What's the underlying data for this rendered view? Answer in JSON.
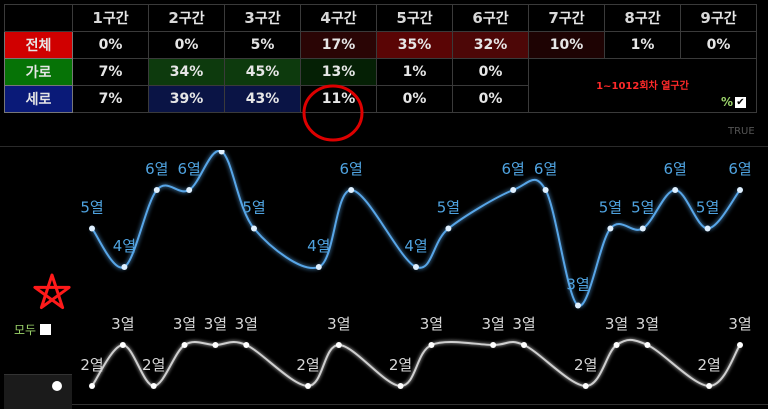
{
  "table": {
    "headers": [
      {
        "num": "1",
        "unit": "구간"
      },
      {
        "num": "2",
        "unit": "구간"
      },
      {
        "num": "3",
        "unit": "구간"
      },
      {
        "num": "4",
        "unit": "구간"
      },
      {
        "num": "5",
        "unit": "구간"
      },
      {
        "num": "6",
        "unit": "구간"
      },
      {
        "num": "7",
        "unit": "구간"
      },
      {
        "num": "8",
        "unit": "구간"
      },
      {
        "num": "9",
        "unit": "구간"
      }
    ],
    "rows": [
      {
        "label": "전체",
        "cls": "total",
        "vcls": "v-total",
        "values": [
          "0%",
          "0%",
          "5%",
          "17%",
          "35%",
          "32%",
          "10%",
          "1%",
          "0%"
        ],
        "bgs": [
          "#000000",
          "#000000",
          "#000000",
          "#2a0505",
          "#5a0505",
          "#4d0707",
          "#1e0303",
          "#000000",
          "#000000"
        ]
      },
      {
        "label": "가로",
        "cls": "garo",
        "vcls": "v-garo",
        "values": [
          "7%",
          "34%",
          "45%",
          "13%",
          "1%",
          "0%"
        ],
        "bgs": [
          "#000000",
          "#0d3a0d",
          "#0d3a0d",
          "#052005",
          "#000000",
          "#000000"
        ]
      },
      {
        "label": "세로",
        "cls": "sero",
        "vcls": "v-sero",
        "values": [
          "7%",
          "39%",
          "43%",
          "11%",
          "0%",
          "0%"
        ],
        "bgs": [
          "#000000",
          "#0a1445",
          "#0a1445",
          "#000000",
          "#000000",
          "#000000"
        ]
      }
    ],
    "range_note": "1~1012회차 열구간",
    "percent_label": "%",
    "percent_checked": "✔",
    "true_label": "TRUE",
    "annotation_circle_color": "#dd0000"
  },
  "all_label": "모두",
  "chart_data": {
    "type": "line",
    "x": [
      1,
      2,
      3,
      4,
      5,
      6,
      7,
      8,
      9,
      10,
      11,
      12,
      13,
      14,
      15,
      16,
      17,
      18,
      19,
      20,
      21,
      22,
      23,
      24,
      25,
      26,
      27,
      28,
      29
    ],
    "series": [
      {
        "color": "#58a6e8",
        "labels": [
          "5열",
          "4열",
          "6열",
          "6열",
          "7열",
          "5열",
          "4열",
          "6열",
          "4열",
          "5열",
          "6열",
          "6열",
          "3열",
          "5열",
          "5열",
          "6열",
          "5열",
          "6열"
        ],
        "values": [
          5,
          4,
          6,
          6,
          7,
          5,
          4,
          6,
          4,
          5,
          6,
          6,
          3,
          5,
          5,
          6,
          5,
          6
        ]
      },
      {
        "color": "#cfcfcf",
        "labels": [
          "2열",
          "3열",
          "2열",
          "3열",
          "3열",
          "3열",
          "2열",
          "3열",
          "2열",
          "3열",
          "3열",
          "3열",
          "2열",
          "3열",
          "3열",
          "2열",
          "3열"
        ],
        "values": [
          2,
          3,
          2,
          3,
          3,
          3,
          2,
          3,
          2,
          3,
          3,
          3,
          2,
          3,
          3,
          2,
          3
        ]
      }
    ]
  }
}
